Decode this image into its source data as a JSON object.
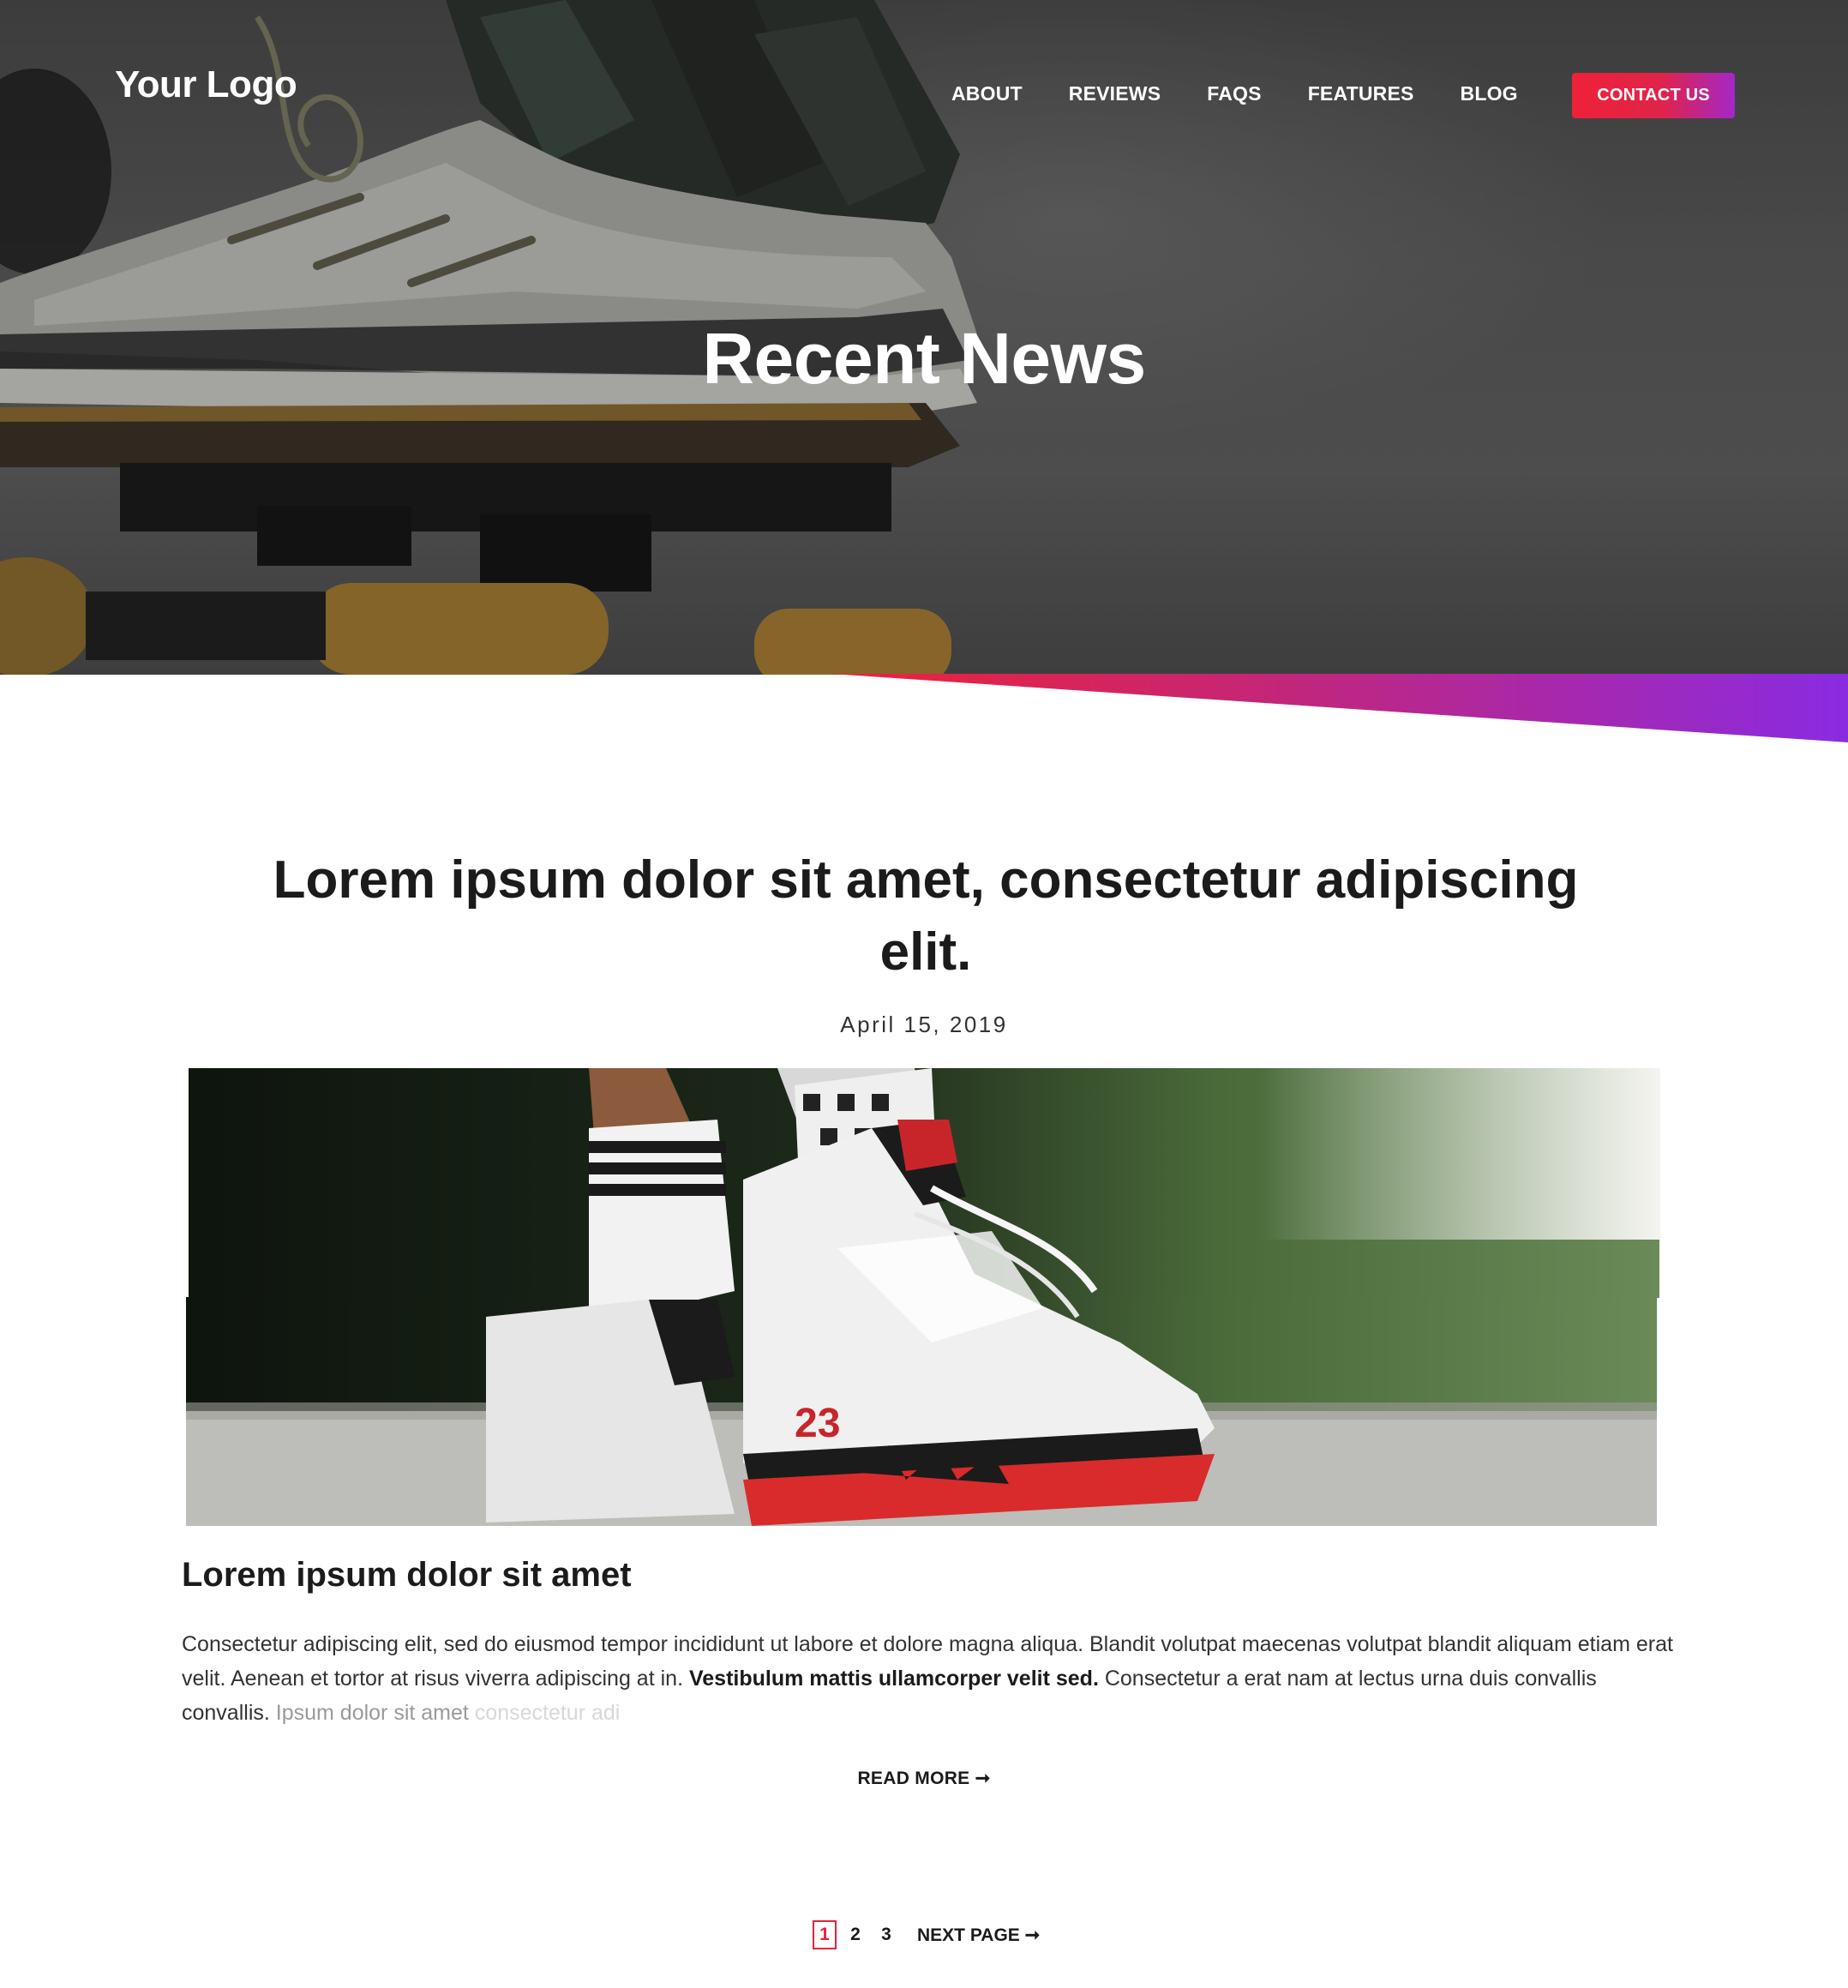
{
  "header": {
    "logo_text": "Your Logo",
    "nav": [
      {
        "label": "ABOUT"
      },
      {
        "label": "REVIEWS"
      },
      {
        "label": "FAQS"
      },
      {
        "label": "FEATURES"
      },
      {
        "label": "BLOG"
      }
    ],
    "contact_label": "CONTACT US"
  },
  "hero": {
    "title": "Recent News"
  },
  "article": {
    "title": "Lorem ipsum dolor sit amet, consectetur adipiscing elit.",
    "date": "April 15, 2019",
    "heading": "Lorem ipsum dolor sit amet",
    "body_start": "Consectetur adipiscing elit, sed do eiusmod tempor incididunt ut labore et dolore magna aliqua. Blandit volutpat maecenas volutpat blandit aliquam etiam erat velit. Aenean et tortor at risus viverra adipiscing at in. ",
    "body_bold": "Vestibulum mattis ullamcorper velit sed.",
    "body_mid": " Consectetur a erat nam at lectus urna duis convallis convallis. ",
    "body_fade": "Ipsum dolor sit amet ",
    "body_fade2": "consectetur adi",
    "read_more": "READ MORE ➞"
  },
  "pagination": {
    "pages": [
      "1",
      "2",
      "3"
    ],
    "current": "1",
    "next_label": "NEXT PAGE ➞"
  },
  "colors": {
    "accent_red": "#e8213a",
    "accent_purple": "#8a2be2"
  }
}
